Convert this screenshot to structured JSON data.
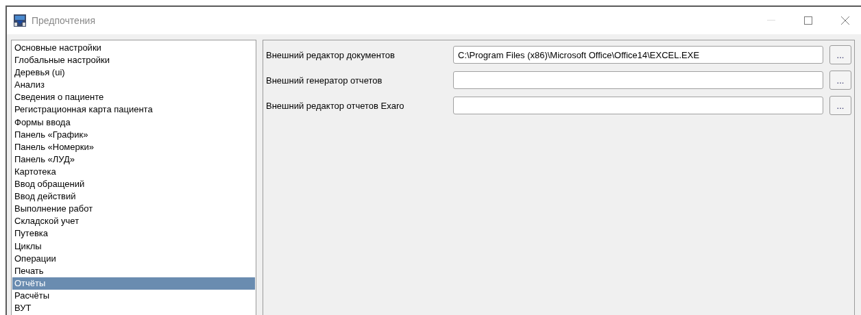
{
  "window": {
    "title": "Предпочтения"
  },
  "sidebar": {
    "items": [
      {
        "label": "Основные настройки",
        "selected": false
      },
      {
        "label": "Глобальные настройки",
        "selected": false
      },
      {
        "label": "Деревья (ui)",
        "selected": false
      },
      {
        "label": "Анализ",
        "selected": false
      },
      {
        "label": "Сведения о пациенте",
        "selected": false
      },
      {
        "label": "Регистрационная карта пациента",
        "selected": false
      },
      {
        "label": "Формы ввода",
        "selected": false
      },
      {
        "label": "Панель «График»",
        "selected": false
      },
      {
        "label": "Панель «Номерки»",
        "selected": false
      },
      {
        "label": "Панель «ЛУД»",
        "selected": false
      },
      {
        "label": "Картотека",
        "selected": false
      },
      {
        "label": "Ввод обращений",
        "selected": false
      },
      {
        "label": "Ввод действий",
        "selected": false
      },
      {
        "label": "Выполнение работ",
        "selected": false
      },
      {
        "label": "Складской учет",
        "selected": false
      },
      {
        "label": "Путевка",
        "selected": false
      },
      {
        "label": "Циклы",
        "selected": false
      },
      {
        "label": "Операции",
        "selected": false
      },
      {
        "label": "Печать",
        "selected": false
      },
      {
        "label": "Отчёты",
        "selected": true
      },
      {
        "label": "Расчёты",
        "selected": false
      },
      {
        "label": "ВУТ",
        "selected": false
      }
    ]
  },
  "settings": [
    {
      "label": "Внешний редактор документов",
      "value": "C:\\Program Files (x86)\\Microsoft Office\\Office14\\EXCEL.EXE",
      "button": "..."
    },
    {
      "label": "Внешний генератор отчетов",
      "button": "..."
    },
    {
      "label": "Внешний редактор отчетов Exaro",
      "button": "..."
    }
  ]
}
